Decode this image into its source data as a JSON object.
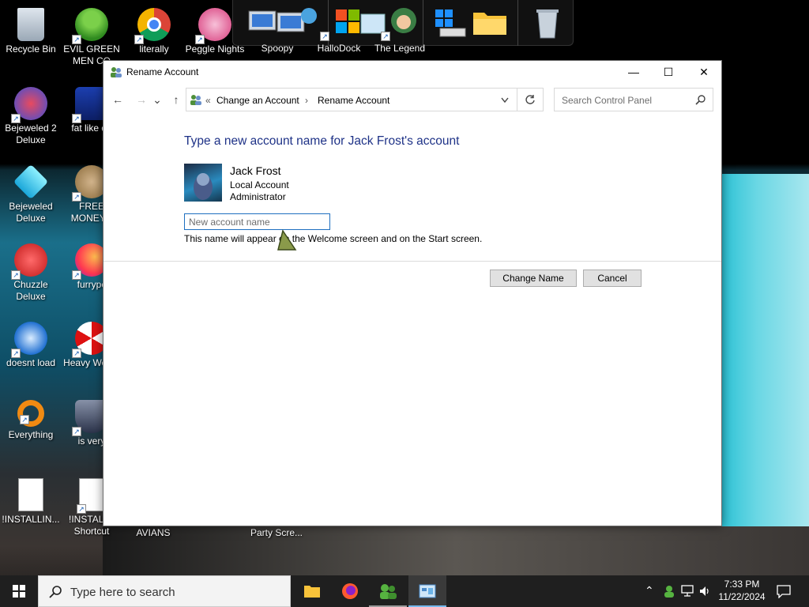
{
  "desktop": {
    "icons": [
      {
        "label": "Recycle Bin"
      },
      {
        "label": "EVIL GREEN MEN CO"
      },
      {
        "label": "literally"
      },
      {
        "label": "Peggle Nights"
      },
      {
        "label": "Spoopy"
      },
      {
        "label": "HalloDock"
      },
      {
        "label": "The Legend"
      },
      {
        "label": "Bejeweled 2 Deluxe"
      },
      {
        "label": "fat like da"
      },
      {
        "label": "Bejeweled Deluxe"
      },
      {
        "label": "FREE MONEY.e"
      },
      {
        "label": "Chuzzle Deluxe"
      },
      {
        "label": "furrypc"
      },
      {
        "label": "doesnt load"
      },
      {
        "label": "Heavy Weap."
      },
      {
        "label": "Everything"
      },
      {
        "label": "is very"
      },
      {
        "label": "!INSTALLIN..."
      },
      {
        "label": "!INSTALL - Shortcut"
      },
      {
        "label": "AVIANS"
      },
      {
        "label": "Party Scre..."
      }
    ]
  },
  "window": {
    "title": "Rename Account",
    "controls": {
      "minimize": "—",
      "maximize": "☐",
      "close": "✕"
    },
    "nav": {
      "back": "←",
      "forward": "→",
      "recent": "⌄",
      "up": "↑"
    },
    "breadcrumb": {
      "overflow": "«",
      "items": [
        "Change an Account",
        "Rename Account"
      ],
      "separator": "›"
    },
    "search": {
      "placeholder": "Search Control Panel"
    },
    "heading": "Type a new account name for Jack Frost's account",
    "account": {
      "name": "Jack Frost",
      "type": "Local Account",
      "role": "Administrator"
    },
    "input": {
      "placeholder": "New account name",
      "value": ""
    },
    "hint": "This name will appear on the Welcome screen and on the Start screen.",
    "buttons": {
      "change": "Change Name",
      "cancel": "Cancel"
    }
  },
  "taskbar": {
    "search_placeholder": "Type here to search",
    "time": "7:33 PM",
    "date": "11/22/2024"
  },
  "colors": {
    "heading": "#1e3287",
    "accent": "#1e6fc0",
    "taskbar": "#1f1f1f"
  }
}
